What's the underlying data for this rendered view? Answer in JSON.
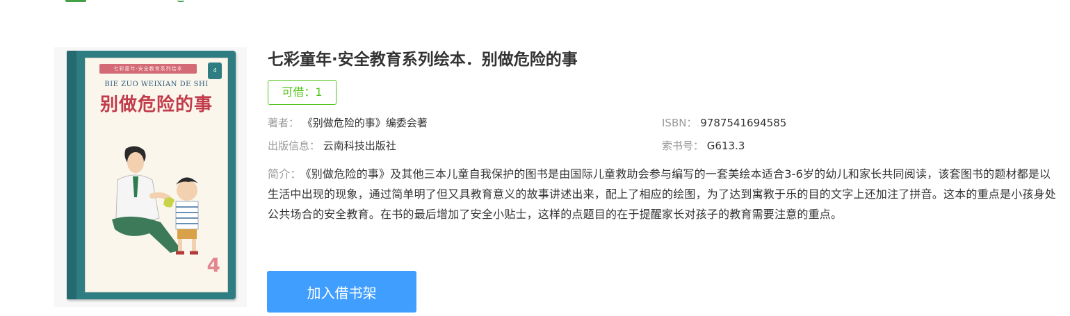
{
  "book": {
    "title": "七彩童年·安全教育系列绘本．别做危险的事",
    "availability": "可借：1",
    "author_label": "著者：",
    "author": "《别做危险的事》编委会著",
    "isbn_label": "ISBN：",
    "isbn": "9787541694585",
    "publisher_label": "出版信息：",
    "publisher": "云南科技出版社",
    "call_number_label": "索书号：",
    "call_number": "G613.3",
    "summary_label": "简介：",
    "summary": "《别做危险的事》及其他三本儿童自我保护的图书是由国际儿童救助会参与编写的一套美绘本适合3-6岁的幼儿和家长共同阅读，该套图书的题材都是以生活中出现的现象，通过简单明了但又具教育意义的故事讲述出来，配上了相应的绘图，为了达到寓教于乐的目的文字上还加注了拼音。这本的重点是小孩身处公共场合的安全教育。在书的最后增加了安全小贴士，这样的点题目的在于提醒家长对孩子的教育需要注意的重点。"
  },
  "cover": {
    "series_ribbon": "七彩童年·安全教育系列绘本",
    "pinyin": "BIE ZUO WEIXIAN DE SHI",
    "title": "别做危险的事",
    "number": "4",
    "colors": {
      "board": "#2e7d83",
      "title": "#c23b4a",
      "panel": "#faf6ec"
    }
  },
  "actions": {
    "add_to_shelf": "加入借书架"
  },
  "colors": {
    "accent_green": "#52c41a",
    "button_blue": "#409eff",
    "label_gray": "#999999",
    "text": "#333333"
  }
}
